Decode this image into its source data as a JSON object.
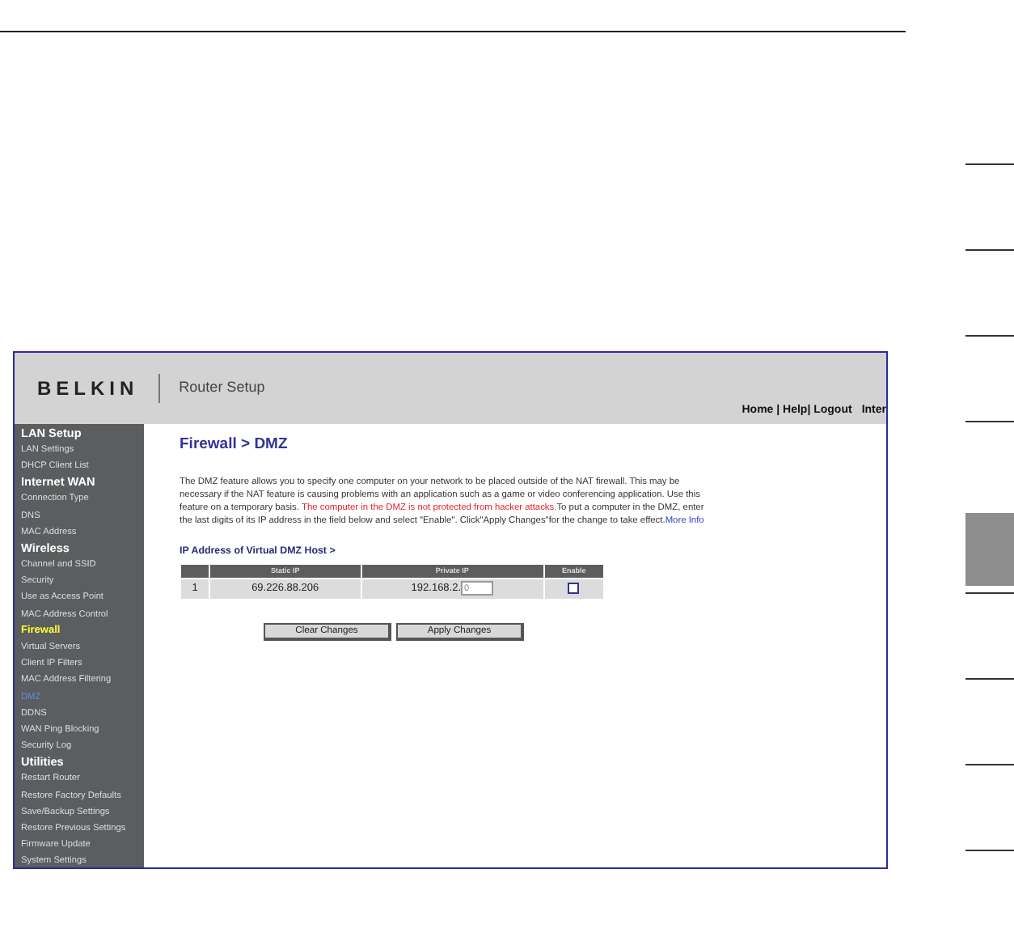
{
  "header": {
    "logo": "BELKIN",
    "title": "Router Setup",
    "links": "Home | Help| Logout",
    "cut_link": "Inter"
  },
  "sidebar": [
    {
      "title": "LAN Setup",
      "items": [
        {
          "label": "LAN Settings",
          "kind": "link",
          "selected": false
        },
        {
          "label": "DHCP Client List",
          "kind": "link",
          "selected": false
        }
      ]
    },
    {
      "title": "Internet WAN",
      "items": [
        {
          "label": "Connection Type",
          "kind": "link",
          "selected": false
        },
        {
          "label": "DNS",
          "kind": "link",
          "selected": false
        },
        {
          "label": "MAC Address",
          "kind": "link",
          "selected": false
        }
      ]
    },
    {
      "title": "Wireless",
      "items": [
        {
          "label": "Channel and SSID",
          "kind": "link",
          "selected": false
        },
        {
          "label": "Security",
          "kind": "link",
          "selected": false
        },
        {
          "label": "Use as Access Point",
          "kind": "link",
          "selected": false
        },
        {
          "label": "MAC Address Control",
          "kind": "link",
          "selected": false
        },
        {
          "label": "Firewall",
          "kind": "section",
          "selected": false
        },
        {
          "label": "Virtual Servers",
          "kind": "link",
          "selected": false
        },
        {
          "label": "Client IP Filters",
          "kind": "link",
          "selected": false
        },
        {
          "label": "MAC Address Filtering",
          "kind": "link",
          "selected": false
        },
        {
          "label": "DMZ",
          "kind": "link",
          "selected": true
        },
        {
          "label": "DDNS",
          "kind": "link",
          "selected": false
        },
        {
          "label": "WAN Ping Blocking",
          "kind": "link",
          "selected": false
        },
        {
          "label": "Security Log",
          "kind": "link",
          "selected": false
        }
      ]
    },
    {
      "title": "Utilities",
      "items": [
        {
          "label": "Restart Router",
          "kind": "link",
          "selected": false
        },
        {
          "label": "Restore Factory Defaults",
          "kind": "link",
          "selected": false
        },
        {
          "label": "Save/Backup Settings",
          "kind": "link",
          "selected": false
        },
        {
          "label": "Restore Previous Settings",
          "kind": "link",
          "selected": false
        },
        {
          "label": "Firmware Update",
          "kind": "link",
          "selected": false
        },
        {
          "label": "System Settings",
          "kind": "link",
          "selected": false
        }
      ]
    }
  ],
  "page_title": "Firewall > DMZ",
  "description": [
    {
      "kind": "text",
      "text": "The DMZ feature allows you to specify one computer on your network to be placed outside of the NAT firewall. This may be necessary if the NAT feature is causing problems with an application such as a game or video conferencing application. Use this feature on a temporary basis. "
    },
    {
      "kind": "warning",
      "text": "The computer in the DMZ is not protected from hacker attacks."
    },
    {
      "kind": "text",
      "text": "To put a computer in the DMZ, enter the last digits of its IP address in the field below and select \"Enable\". Click\"Apply Changes\"for the change to take effect."
    },
    {
      "kind": "link",
      "text": "More Info"
    }
  ],
  "section_title": "IP Address of Virtual DMZ Host >",
  "table": {
    "columns": [
      "Static IP",
      "Private IP",
      "Enable"
    ],
    "rows": [
      {
        "number": "1",
        "static_ip": "69.226.88.206",
        "private_prefix": "192.168.2.",
        "private_value": "0",
        "enabled": false
      }
    ]
  },
  "buttons": [
    "Clear Changes",
    "Apply Changes"
  ],
  "page_tabs": [
    {
      "selected": false
    },
    {
      "selected": false
    },
    {
      "selected": false
    },
    {
      "selected": false
    },
    {
      "selected": true
    },
    {
      "selected": false
    },
    {
      "selected": false
    },
    {
      "selected": false
    },
    {
      "selected": false
    }
  ]
}
